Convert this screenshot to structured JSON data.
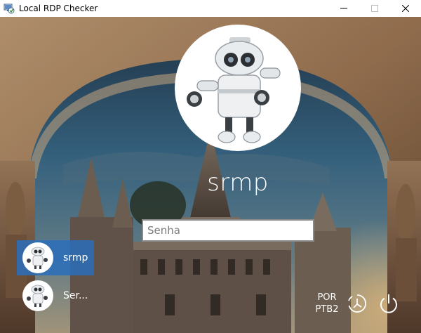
{
  "window": {
    "title": "Local RDP Checker",
    "controls": [
      "minimize-icon",
      "maximize-icon",
      "close-icon"
    ]
  },
  "lock_screen": {
    "background": "castle-archway-sunset",
    "username": "srmp",
    "password": {
      "placeholder": "Senha",
      "value": ""
    },
    "users": [
      {
        "name": "srmp",
        "selected": true,
        "avatar": "robot-avatar"
      },
      {
        "name": "Ser...",
        "selected": false,
        "avatar": "robot-avatar"
      }
    ],
    "language": {
      "line1": "POR",
      "line2": "PTB2"
    },
    "buttons": [
      "accessibility-icon",
      "power-icon"
    ]
  },
  "colors": {
    "selection": "#2a6ebb",
    "text": "#ffffff"
  }
}
